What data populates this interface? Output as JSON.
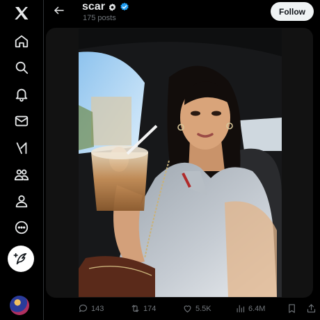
{
  "header": {
    "title": "scar",
    "subtitle": "175 posts",
    "follow_label": "Follow"
  },
  "nav": {
    "items": [
      {
        "icon": "x-logo-icon"
      },
      {
        "icon": "home-icon"
      },
      {
        "icon": "search-icon"
      },
      {
        "icon": "notifications-icon"
      },
      {
        "icon": "messages-icon"
      },
      {
        "icon": "grok-icon"
      },
      {
        "icon": "communities-icon"
      },
      {
        "icon": "profile-icon"
      },
      {
        "icon": "more-icon"
      }
    ],
    "compose_icon": "compose-post-icon"
  },
  "post": {
    "image_description": "selfie in car holding iced coffee",
    "stats": {
      "replies": "143",
      "reposts": "174",
      "likes": "5.5K",
      "views": "6.4M"
    }
  },
  "colors": {
    "background": "#000000",
    "text": "#e7e9ea",
    "muted": "#71767b",
    "verified": "#1d9bf0",
    "follow_bg": "#eff3f4"
  }
}
